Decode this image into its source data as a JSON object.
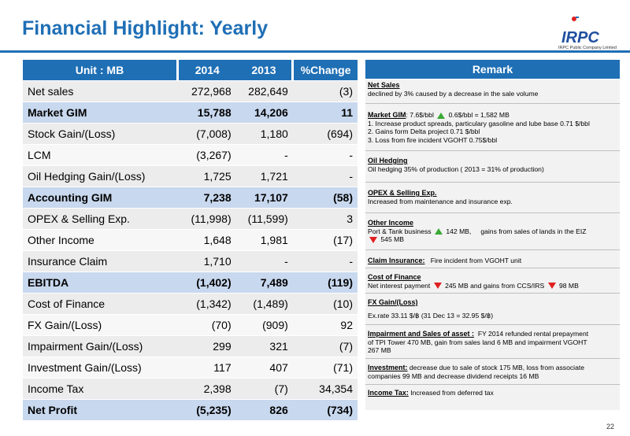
{
  "header": {
    "title": "Financial Highlight:  Yearly",
    "logo_text": "IRPC",
    "logo_subtext": "IRPC Public Company Limited"
  },
  "table": {
    "headers": [
      "Unit : MB",
      "2014",
      "2013",
      "%Change"
    ],
    "rows": [
      {
        "label": "Net sales",
        "y2014": "272,968",
        "y2013": "282,649",
        "change": "(3)",
        "highlight": false
      },
      {
        "label": "Market GIM",
        "y2014": "15,788",
        "y2013": "14,206",
        "change": "11",
        "highlight": true
      },
      {
        "label": "Stock Gain/(Loss)",
        "y2014": "(7,008)",
        "y2013": "1,180",
        "change": "(694)",
        "highlight": false
      },
      {
        "label": "LCM",
        "y2014": "(3,267)",
        "y2013": "-",
        "change": "-",
        "highlight": false
      },
      {
        "label": "Oil Hedging Gain/(Loss)",
        "y2014": "1,725",
        "y2013": "1,721",
        "change": "-",
        "highlight": false
      },
      {
        "label": "Accounting GIM",
        "y2014": "7,238",
        "y2013": "17,107",
        "change": "(58)",
        "highlight": true
      },
      {
        "label": "OPEX & Selling Exp.",
        "y2014": "(11,998)",
        "y2013": "(11,599)",
        "change": "3",
        "highlight": false
      },
      {
        "label": "Other Income",
        "y2014": "1,648",
        "y2013": "1,981",
        "change": "(17)",
        "highlight": false
      },
      {
        "label": "Insurance Claim",
        "y2014": "1,710",
        "y2013": "-",
        "change": "-",
        "highlight": false
      },
      {
        "label": "EBITDA",
        "y2014": "(1,402)",
        "y2013": "7,489",
        "change": "(119)",
        "highlight": true
      },
      {
        "label": "Cost of Finance",
        "y2014": "(1,342)",
        "y2013": "(1,489)",
        "change": "(10)",
        "highlight": false
      },
      {
        "label": "FX Gain/(Loss)",
        "y2014": "(70)",
        "y2013": "(909)",
        "change": "92",
        "highlight": false
      },
      {
        "label": "Impairment Gain/(Loss)",
        "y2014": "299",
        "y2013": "321",
        "change": "(7)",
        "highlight": false
      },
      {
        "label": "Investment Gain/(Loss)",
        "y2014": "117",
        "y2013": "407",
        "change": "(71)",
        "highlight": false
      },
      {
        "label": "Income Tax",
        "y2014": "2,398",
        "y2013": "(7)",
        "change": "34,354",
        "highlight": false
      },
      {
        "label": "Net Profit",
        "y2014": "(5,235)",
        "y2013": "826",
        "change": "(734)",
        "highlight": true
      }
    ]
  },
  "remark": {
    "title": "Remark",
    "net_sales_h": "Net Sales",
    "net_sales_t": "declined by 3% caused by a decrease in the sale volume",
    "gim_h": "Market GIM",
    "gim_t1": ":  7.6$/bbl",
    "gim_t2": "0.6$/bbl = 1,582 MB",
    "gim_l1": "1.  Increase product spreads, particulary gasoline and lube base 0.71 $/bbl",
    "gim_l2": "2.  Gains form Delta project 0.71 $/bbl",
    "gim_l3": "3.  Loss from fire incident VGOHT 0.75$/bbl",
    "hedge_h": "Oil Hedging",
    "hedge_t": "Oil hedging 35% of  production ( 2013 = 31% of production)",
    "opex_h": "OPEX & Selling Exp.",
    "opex_t": "Increased from maintenance and insurance exp.",
    "other_h": "Other Income",
    "other_t1": "Port & Tank business",
    "other_t2": "142 MB,",
    "other_t3": "gains from sales of lands in the EIZ",
    "other_t4": "545 MB",
    "claim_h": "Claim Insurance:",
    "claim_t": "Fire incident from  VGOHT unit",
    "cof_h": "Cost of Finance",
    "cof_t1": "Net interest payment",
    "cof_t2": "245 MB and gains from  CCS/IRS",
    "cof_t3": "98 MB",
    "fx_h": "FX Gain/(Loss)",
    "fx_t": "Ex.rate 33.11 $/฿ (31 Dec 13 = 32.95 $/฿)",
    "imp_h": "Impairment and Sales of asset :",
    "imp_t1": "FY 2014 refunded rental prepayment",
    "imp_t2": "of  TPI Tower 470 MB, gain from sales land 6 MB and impairment VGOHT",
    "imp_t3": "267 MB",
    "inv_h": "Investment:",
    "inv_t1": "decrease  due to sale of stock 175 MB, loss from associate",
    "inv_t2": "companies 99 MB and decrease dividend receipts 16 MB",
    "tax_h": "Income Tax:",
    "tax_t": "Increased from deferred tax"
  },
  "page_number": "22",
  "colors": {
    "accent": "#1f6fb5",
    "highlight_row": "#c8d8ee",
    "arrow_up": "#3aa935",
    "arrow_down": "#e02020"
  }
}
